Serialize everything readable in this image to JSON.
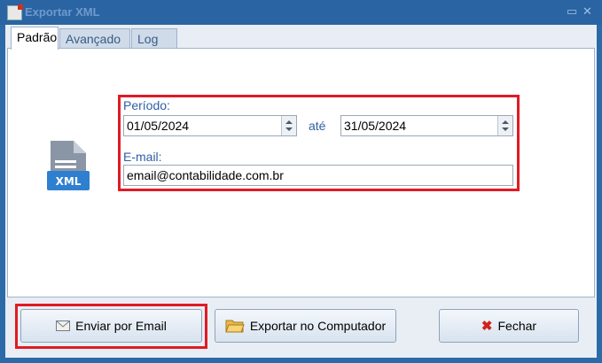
{
  "window": {
    "title": "Exportar XML"
  },
  "tabs": [
    {
      "label": "Padrão"
    },
    {
      "label": "Avançado"
    },
    {
      "label": "Log"
    }
  ],
  "icon": {
    "name": "xml-file-icon",
    "text": "XML"
  },
  "periodo": {
    "label": "Período:",
    "start": "01/05/2024",
    "separator": "até",
    "end": "31/05/2024"
  },
  "email": {
    "label": "E-mail:",
    "value": "email@contabilidade.com.br"
  },
  "buttons": {
    "send_email": "Enviar por Email",
    "export_computer": "Exportar no Computador",
    "close": "Fechar"
  }
}
